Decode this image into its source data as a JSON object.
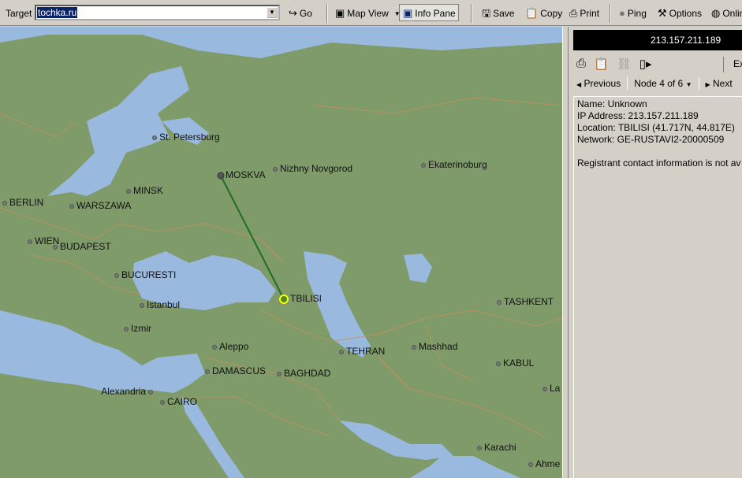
{
  "toolbar": {
    "target_label": "Target",
    "target_value": "tochka.ru",
    "go": "Go",
    "map_view": "Map View",
    "info_pane": "Info Pane",
    "save": "Save",
    "copy": "Copy",
    "print": "Print",
    "ping": "Ping",
    "options": "Options",
    "online": "Onlin"
  },
  "map": {
    "cities": [
      "St. Petersburg",
      "MOSKVA",
      "Nizhny Novgorod",
      "Ekaterinoburg",
      "MINSK",
      "BERLIN",
      "WARSZAWA",
      "WIEN",
      "BUDAPEST",
      "BUCURESTI",
      "Istanbul",
      "Izmir",
      "TBILISI",
      "TASHKENT",
      "Aleppo",
      "Mashhad",
      "TEHRAN",
      "KABUL",
      "DAMASCUS",
      "BAGHDAD",
      "Alexandria",
      "CAIRO",
      "La",
      "Karachi",
      "Ahme"
    ],
    "route": {
      "from": "MOSKVA",
      "to": "TBILISI",
      "color": "#1f6e1f"
    },
    "land_color": "#7f9b6a",
    "water_color": "#9ab9df",
    "border_color": "#c8905a"
  },
  "panel": {
    "ip": "213.157.211.189",
    "export": "Ex",
    "previous": "Previous",
    "node": "Node 4 of 6",
    "next": "Next",
    "info": [
      "Name: Unknown",
      "IP Address: 213.157.211.189",
      "Location: TBILISI (41.717N,  44.817E)",
      "Network: GE-RUSTAVI2-20000509",
      "",
      "Registrant contact information is not av"
    ]
  }
}
